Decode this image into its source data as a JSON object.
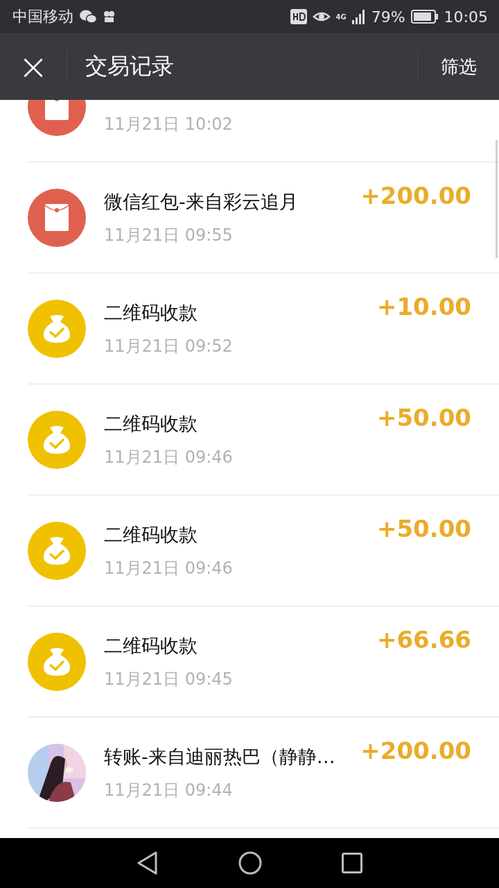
{
  "status_bar": {
    "carrier": "中国移动",
    "battery": "79%",
    "time": "10:05",
    "network": "4G"
  },
  "header": {
    "close": "×",
    "title": "交易记录",
    "action": "筛选"
  },
  "transactions": [
    {
      "kind": "redpacket",
      "date": "11月21日 10:02"
    },
    {
      "kind": "redpacket",
      "title": "微信红包-来自彩云追月",
      "amount": "+200.00",
      "date": "11月21日 09:55"
    },
    {
      "kind": "qrpay",
      "title": "二维码收款",
      "amount": "+10.00",
      "date": "11月21日 09:52"
    },
    {
      "kind": "qrpay",
      "title": "二维码收款",
      "amount": "+50.00",
      "date": "11月21日 09:46"
    },
    {
      "kind": "qrpay",
      "title": "二维码收款",
      "amount": "+50.00",
      "date": "11月21日 09:46"
    },
    {
      "kind": "qrpay",
      "title": "二维码收款",
      "amount": "+66.66",
      "date": "11月21日 09:45"
    },
    {
      "kind": "picture",
      "title": "转账-来自迪丽热巴（静静…",
      "amount": "+200.00",
      "date": "11月21日 09:44"
    }
  ]
}
